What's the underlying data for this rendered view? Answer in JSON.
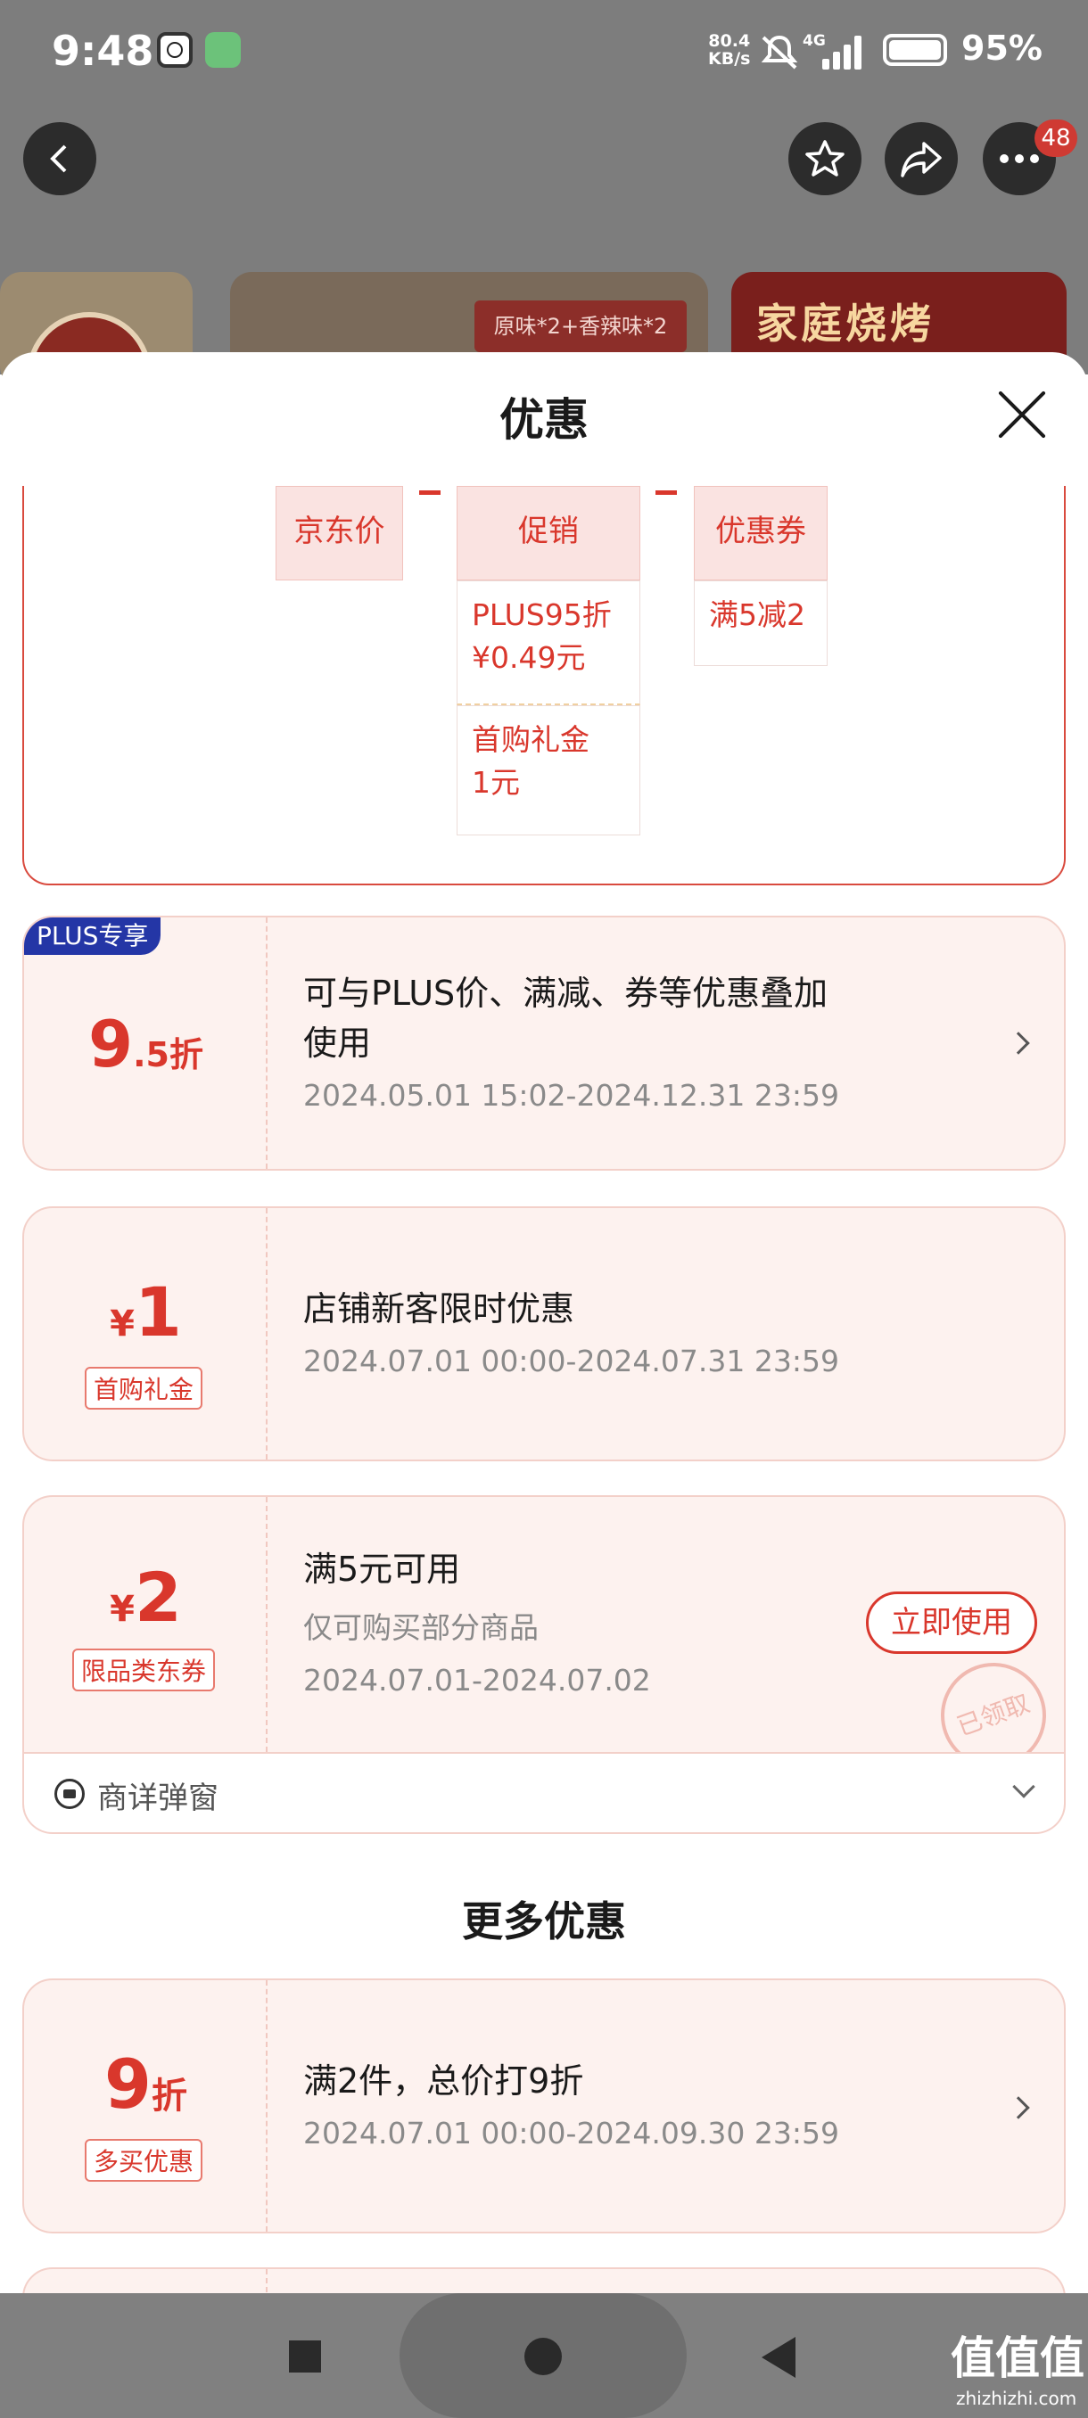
{
  "status_bar": {
    "time": "9:48",
    "net_speed_value": "80.4",
    "net_speed_unit": "KB/s",
    "network": "4G",
    "battery": "95%"
  },
  "header": {
    "badge_count": "48",
    "icons": [
      "back-icon",
      "star-icon",
      "share-icon",
      "more-icon"
    ]
  },
  "background": {
    "card1_text": "原味*2+香辣味*2",
    "card2_text": "家庭烧烤"
  },
  "sheet": {
    "title": "优惠",
    "price_calc": {
      "cols": [
        {
          "label": "京东价"
        },
        {
          "label": "促销",
          "items": [
            "PLUS95折\n¥0.49元",
            "首购礼金\n1元"
          ]
        },
        {
          "label": "优惠券",
          "items": [
            "满5减2"
          ]
        }
      ]
    },
    "coupons": [
      {
        "badge": "PLUS专享",
        "amount_big": "9",
        "amount_small": ".5折",
        "title_line1": "可与PLUS价、满减、券等优惠叠加",
        "title_line2": "使用",
        "time": "2024.05.01 15:02-2024.12.31 23:59"
      },
      {
        "currency": "¥",
        "amount_big": "1",
        "tag": "首购礼金",
        "title_line1": "店铺新客限时优惠",
        "time": "2024.07.01 00:00-2024.07.31 23:59"
      },
      {
        "currency": "¥",
        "amount_big": "2",
        "tag": "限品类东券",
        "title_line1": "满5元可用",
        "sub": "仅可购买部分商品",
        "time": "2024.07.01-2024.07.02",
        "button": "立即使用",
        "stamp": "已领取",
        "popup_label": "商详弹窗"
      }
    ],
    "more_title": "更多优惠",
    "more": [
      {
        "amount_big": "9",
        "amount_small": "折",
        "tag": "多买优惠",
        "title_line1": "满2件，总价打9折",
        "time": "2024.07.01 00:00-2024.09.30 23:59"
      }
    ]
  },
  "watermark": {
    "main": "值值值",
    "sub": "zhizhizhi.com"
  }
}
